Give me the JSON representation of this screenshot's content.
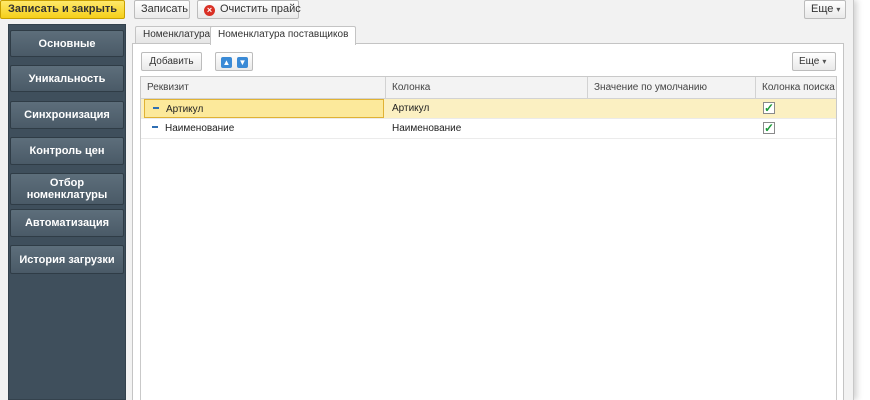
{
  "toolbar": {
    "save_close_label": "Записать и закрыть",
    "save_label": "Записать",
    "clear_price_label": "Очистить прайс",
    "more_label": "Еще"
  },
  "sidebar": {
    "items": [
      {
        "label": "Основные"
      },
      {
        "label": "Уникальность"
      },
      {
        "label": "Синхронизация"
      },
      {
        "label": "Контроль цен"
      },
      {
        "label": "Отбор номенклатуры"
      },
      {
        "label": "Автоматизация"
      },
      {
        "label": "История загрузки"
      }
    ]
  },
  "tabs": [
    {
      "label": "Номенклатура",
      "active": false
    },
    {
      "label": "Номенклатура поставщиков",
      "active": true
    }
  ],
  "table_toolbar": {
    "add_label": "Добавить",
    "more_label": "Еще"
  },
  "table": {
    "columns": [
      "Реквизит",
      "Колонка",
      "Значение по умолчанию",
      "Колонка поиска"
    ],
    "rows": [
      {
        "attribute": "Артикул",
        "column": "Артикул",
        "default": "",
        "search": true,
        "selected": true
      },
      {
        "attribute": "Наименование",
        "column": "Наименование",
        "default": "",
        "search": true,
        "selected": false
      }
    ]
  },
  "colors": {
    "primary_button": "#f5cf1a",
    "sidebar_bg": "#3f4f5c",
    "selected_row": "#fbf0c2",
    "accent_blue": "#3a8ad6"
  }
}
